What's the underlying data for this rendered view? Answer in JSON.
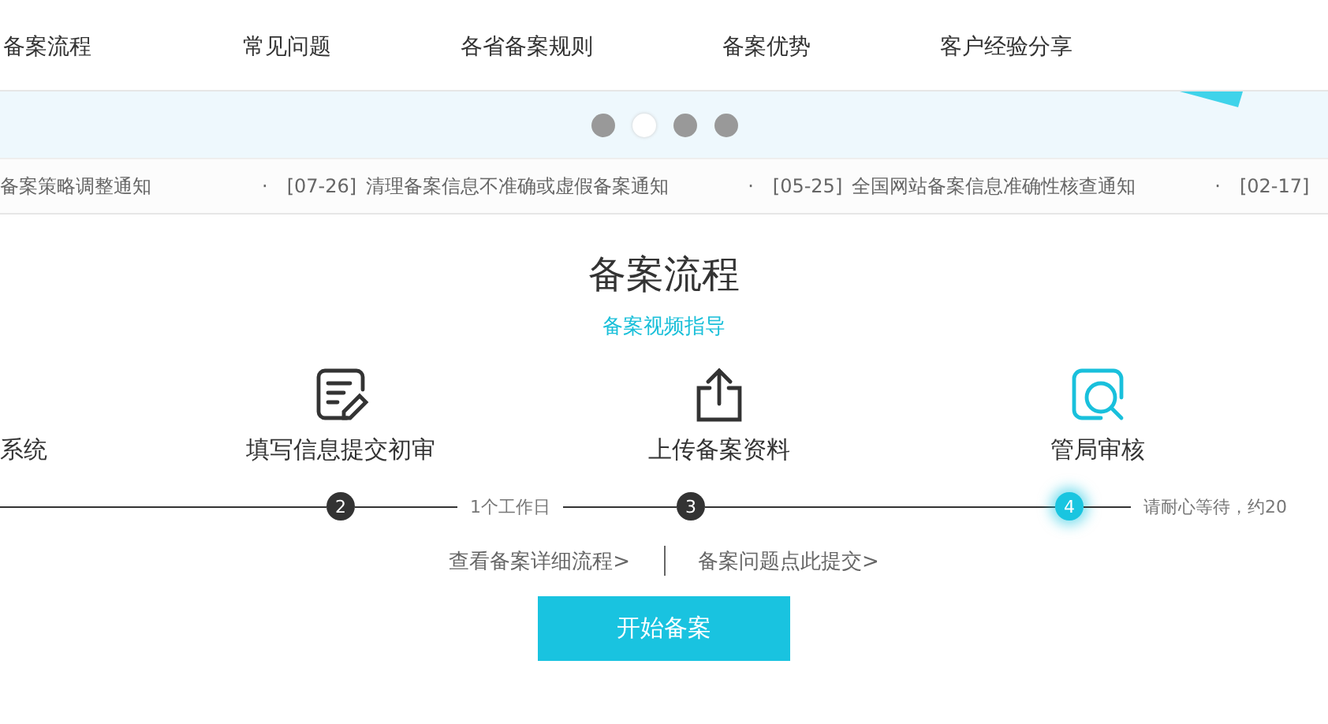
{
  "nav": [
    {
      "label": "备案流程"
    },
    {
      "label": "常见问题"
    },
    {
      "label": "各省备案规则"
    },
    {
      "label": "备案优势"
    },
    {
      "label": "客户经验分享"
    }
  ],
  "carousel": {
    "dots": [
      {
        "selected": false
      },
      {
        "selected": true
      },
      {
        "selected": false
      },
      {
        "selected": false
      }
    ]
  },
  "notices": [
    {
      "text": "备案策略调整通知"
    },
    {
      "bullet": "·",
      "date": "[07-26]",
      "text": "清理备案信息不准确或虚假备案通知"
    },
    {
      "bullet": "·",
      "date": "[05-25]",
      "text": "全国网站备案信息准确性核查通知"
    },
    {
      "bullet": "·",
      "date": "[02-17]"
    }
  ],
  "section": {
    "title": "备案流程",
    "video_link": "备案视频指导"
  },
  "steps": [
    {
      "label": "系统"
    },
    {
      "label": "填写信息提交初审",
      "number": "2",
      "kind": "form",
      "active": false
    },
    {
      "label": "上传备案资料",
      "number": "3",
      "kind": "upload",
      "active": false
    },
    {
      "label": "管局审核",
      "number": "4",
      "kind": "review",
      "active": true
    }
  ],
  "durations": [
    "1个工作日",
    "请耐心等待，约20"
  ],
  "links": [
    "查看备案详细流程>",
    "备案问题点此提交>"
  ],
  "start_button": "开始备案"
}
